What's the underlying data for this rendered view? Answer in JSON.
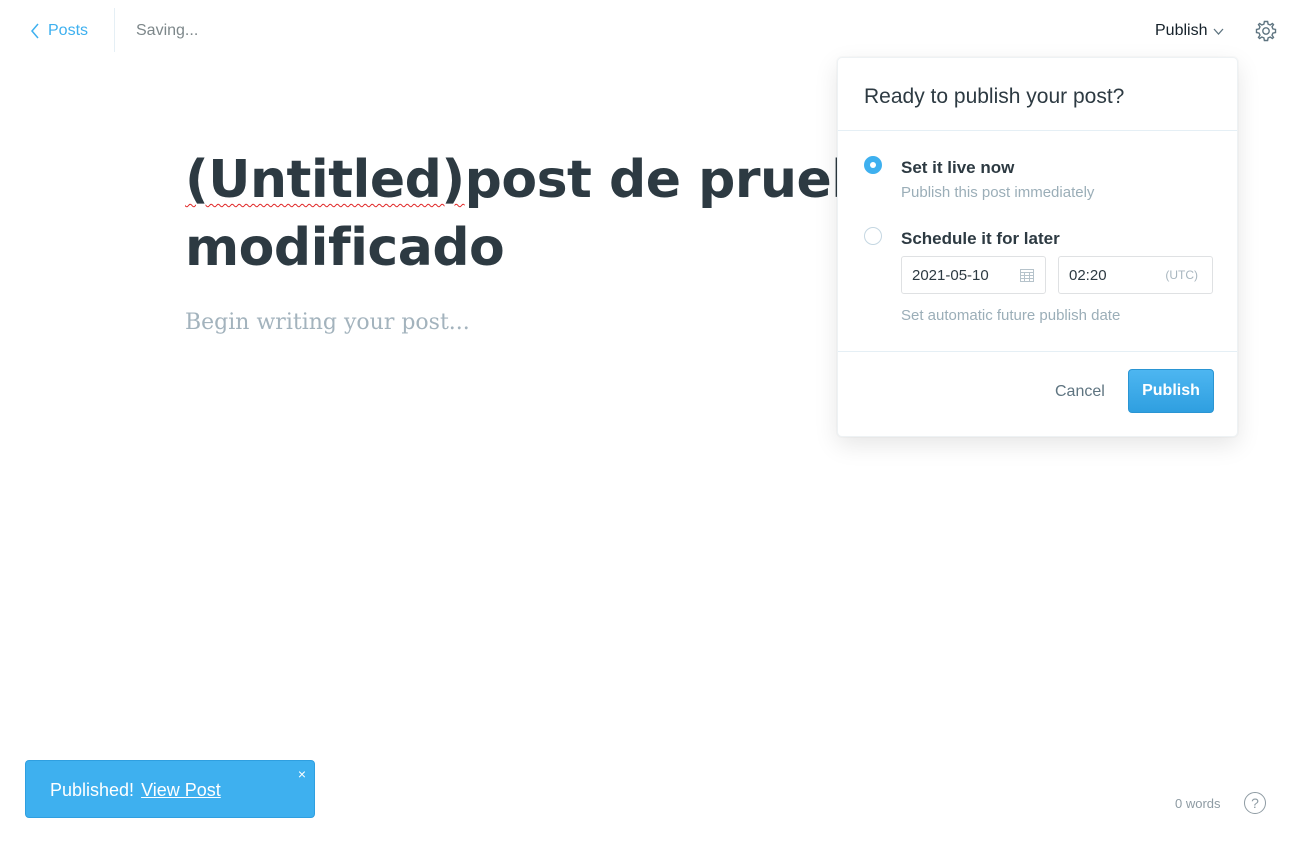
{
  "header": {
    "back_label": "Posts",
    "status": "Saving...",
    "publish_menu_label": "Publish"
  },
  "editor": {
    "title_prefix": "(Untitled)",
    "title_rest": "post de prueba modificado",
    "body_placeholder": "Begin writing your post..."
  },
  "publish_panel": {
    "title": "Ready to publish your post?",
    "option_now": {
      "label": "Set it live now",
      "hint": "Publish this post immediately",
      "selected": true
    },
    "option_schedule": {
      "label": "Schedule it for later",
      "date": "2021-05-10",
      "time": "02:20",
      "timezone": "(UTC)",
      "hint": "Set automatic future publish date",
      "selected": false
    },
    "cancel_label": "Cancel",
    "publish_label": "Publish"
  },
  "notification": {
    "message": "Published!",
    "link_label": "View Post",
    "close_glyph": "×"
  },
  "footer": {
    "word_count": "0 words",
    "help_glyph": "?"
  },
  "colors": {
    "accent": "#3eb0ef",
    "text_dark": "#2d3a42",
    "muted": "#9baeb8"
  },
  "icons": [
    "chevron-left-icon",
    "chevron-down-icon",
    "gear-icon",
    "calendar-icon",
    "close-icon",
    "help-icon"
  ]
}
